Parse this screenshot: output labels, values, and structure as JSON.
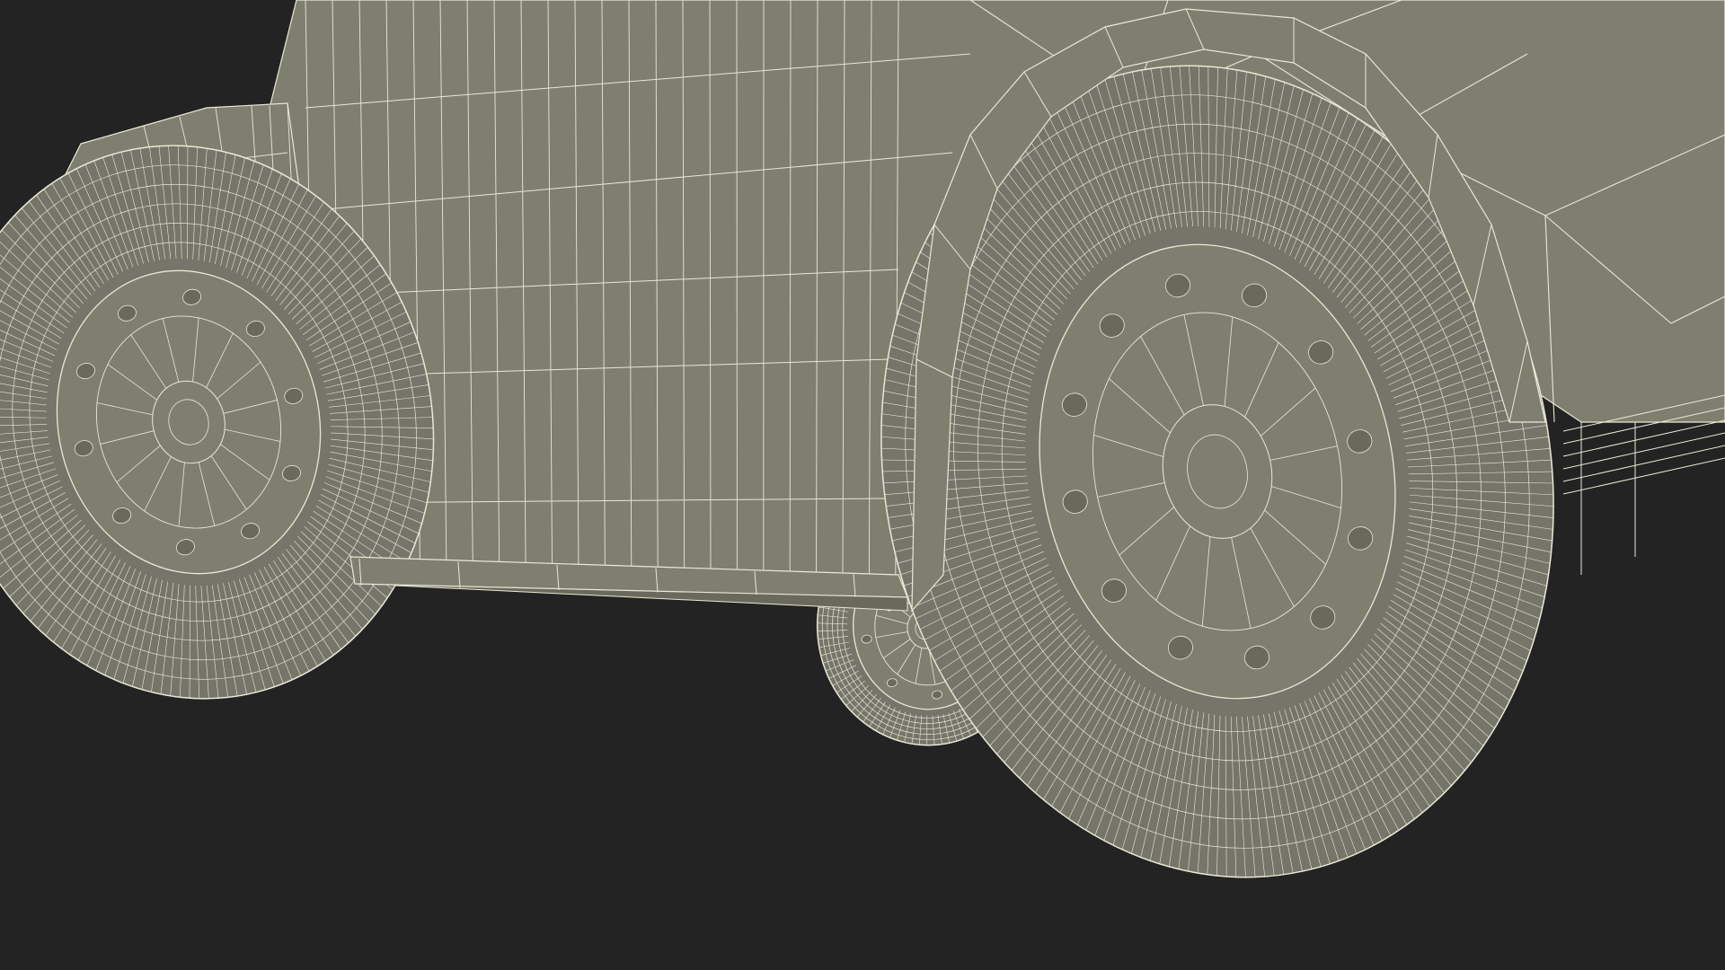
{
  "scene": {
    "subject": "wireframe-car-underside",
    "colors": {
      "background": "#232323",
      "surface": "#7f7f70",
      "surface_dark": "#6a6a5c",
      "tire": "#75756a",
      "wire": "#e9e8d6"
    }
  }
}
